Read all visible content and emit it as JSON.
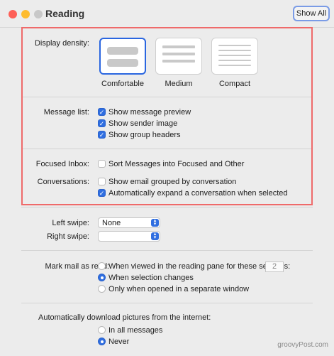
{
  "window": {
    "title": "Reading",
    "show_all_label": "Show All",
    "traffic_lights": {
      "close": "#fe5f57",
      "minimize": "#febc2e",
      "zoom": "#28c840"
    }
  },
  "display_density": {
    "label": "Display density:",
    "options": [
      {
        "label": "Comfortable",
        "selected": true
      },
      {
        "label": "Medium",
        "selected": false
      },
      {
        "label": "Compact",
        "selected": false
      }
    ]
  },
  "message_list": {
    "label": "Message list:",
    "options": [
      {
        "label": "Show message preview",
        "checked": true
      },
      {
        "label": "Show sender image",
        "checked": true
      },
      {
        "label": "Show group headers",
        "checked": true
      }
    ]
  },
  "focused_inbox": {
    "label": "Focused Inbox:",
    "option": {
      "label": "Sort Messages into Focused and Other",
      "checked": false
    }
  },
  "conversations": {
    "label": "Conversations:",
    "options": [
      {
        "label": "Show email grouped by conversation",
        "checked": false
      },
      {
        "label": "Automatically expand a conversation when selected",
        "checked": true
      }
    ]
  },
  "swipe": {
    "left_label": "Left swipe:",
    "left_value": "None",
    "right_label": "Right swipe:",
    "right_value": ""
  },
  "mark_read": {
    "label": "Mark mail as read:",
    "options": [
      {
        "label": "When viewed in the reading pane for these seconds:",
        "selected": false
      },
      {
        "label": "When selection changes",
        "selected": true
      },
      {
        "label": "Only when opened in a separate window",
        "selected": false
      }
    ],
    "seconds_value": "2"
  },
  "download_pictures": {
    "label": "Automatically download pictures from the internet:",
    "options": [
      {
        "label": "In all messages",
        "selected": false
      },
      {
        "label": "Never",
        "selected": true
      }
    ]
  },
  "watermark": "groovyPost.com",
  "highlight_color": "#ef6a6a"
}
